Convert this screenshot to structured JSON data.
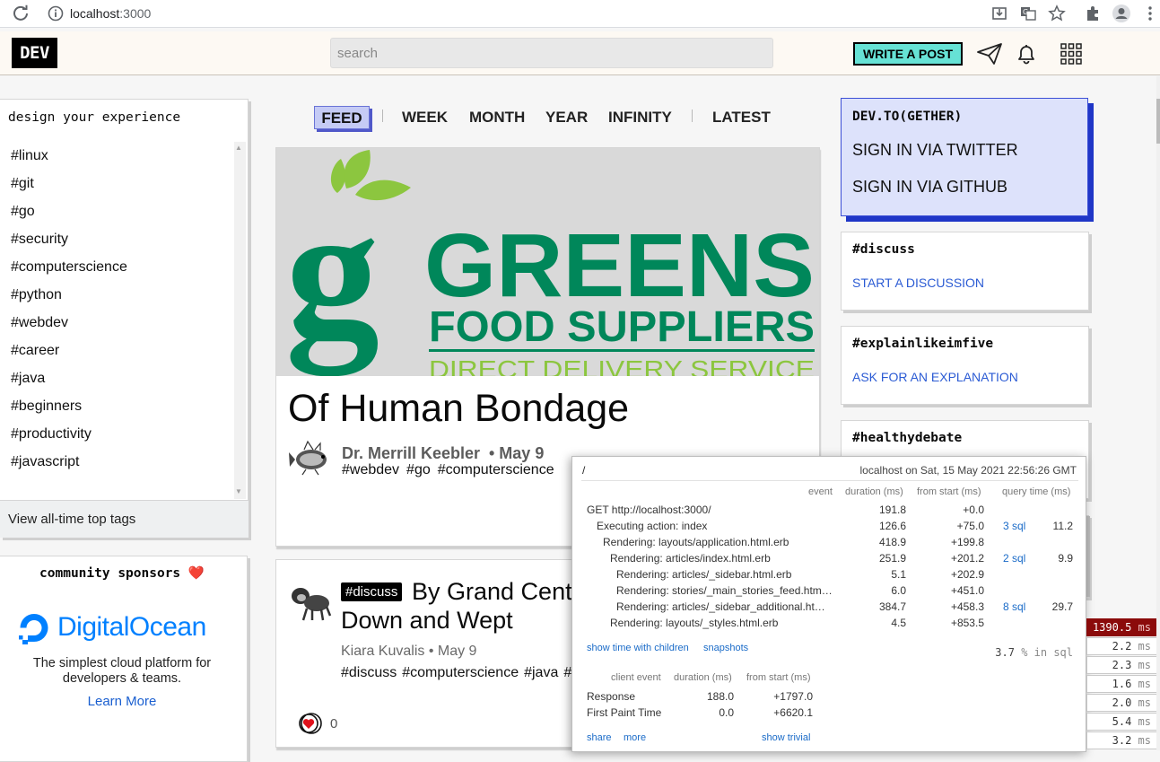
{
  "browser": {
    "url_host": "localhost",
    "url_port": ":3000"
  },
  "header": {
    "logo": "DEV",
    "search_placeholder": "search",
    "write_post": "WRITE A POST"
  },
  "left": {
    "design_title": "design your experience",
    "tags": [
      "#linux",
      "#git",
      "#go",
      "#security",
      "#computerscience",
      "#python",
      "#webdev",
      "#career",
      "#java",
      "#beginners",
      "#productivity",
      "#javascript"
    ],
    "all_time": "View all-time top tags",
    "sponsor_title": "community sponsors ❤️",
    "sponsor_name": "DigitalOcean",
    "sponsor_desc": "The simplest cloud platform for developers & teams.",
    "sponsor_link": "Learn More"
  },
  "feed_nav": {
    "feed": "FEED",
    "week": "WEEK",
    "month": "MONTH",
    "year": "YEAR",
    "infinity": "INFINITY",
    "latest": "LATEST"
  },
  "card1": {
    "cover_line1": "GREENS",
    "cover_line2": "FOOD SUPPLIERS",
    "cover_line3": "DIRECT DELIVERY SERVICE",
    "title": "Of Human Bondage",
    "author": "Dr. Merrill Keebler",
    "date": "• May 9",
    "tags": [
      "#webdev",
      "#go",
      "#computerscience"
    ]
  },
  "card2": {
    "badge": "#discuss",
    "title_line1": "By Grand Cent",
    "title_line2": "Down and Wept",
    "author_line": "Kiara Kuvalis • May 9",
    "tags": [
      "#discuss",
      "#computerscience",
      "#java",
      "#"
    ],
    "reactions": "0"
  },
  "right": {
    "signin_title": "DEV.TO(GETHER)",
    "signin_twitter": "SIGN IN VIA TWITTER",
    "signin_github": "SIGN IN VIA GITHUB",
    "cards": [
      {
        "title": "#discuss",
        "link": "START A DISCUSSION"
      },
      {
        "title": "#explainlikeimfive",
        "link": "ASK FOR AN EXPLANATION"
      },
      {
        "title": "#healthydebate",
        "link": ""
      }
    ]
  },
  "profiler": {
    "path": "/",
    "host": "localhost on Sat, 15 May 2021 22:56:26 GMT",
    "headers": {
      "event": "event",
      "duration": "duration (ms)",
      "from_start": "from start (ms)",
      "query_time": "query time (ms)"
    },
    "rows": [
      {
        "event": "GET http://localhost:3000/",
        "duration": "191.8",
        "from_start": "+0.0",
        "sql": "",
        "query_time": ""
      },
      {
        "event": "Executing action: index",
        "duration": "126.6",
        "from_start": "+75.0",
        "sql": "3 sql",
        "query_time": "11.2"
      },
      {
        "event": "Rendering: layouts/application.html.erb",
        "duration": "418.9",
        "from_start": "+199.8",
        "sql": "",
        "query_time": ""
      },
      {
        "event": "Rendering: articles/index.html.erb",
        "duration": "251.9",
        "from_start": "+201.2",
        "sql": "2 sql",
        "query_time": "9.9"
      },
      {
        "event": "Rendering: articles/_sidebar.html.erb",
        "duration": "5.1",
        "from_start": "+202.9",
        "sql": "",
        "query_time": ""
      },
      {
        "event": "Rendering: stories/_main_stories_feed.htm…",
        "duration": "6.0",
        "from_start": "+451.0",
        "sql": "",
        "query_time": ""
      },
      {
        "event": "Rendering: articles/_sidebar_additional.ht…",
        "duration": "384.7",
        "from_start": "+458.3",
        "sql": "8 sql",
        "query_time": "29.7"
      },
      {
        "event": "Rendering: layouts/_styles.html.erb",
        "duration": "4.5",
        "from_start": "+853.5",
        "sql": "",
        "query_time": ""
      }
    ],
    "show_time": "show time with children",
    "snapshots": "snapshots",
    "pct_value": "3.7",
    "pct_label": "% in sql",
    "client_headers": {
      "event": "client event",
      "duration": "duration (ms)",
      "from_start": "from start (ms)"
    },
    "client_rows": [
      {
        "event": "Response",
        "duration": "188.0",
        "from_start": "+1797.0"
      },
      {
        "event": "First Paint Time",
        "duration": "0.0",
        "from_start": "+6620.1"
      }
    ],
    "share": "share",
    "more": "more",
    "show_trivial": "show trivial"
  },
  "mini_profiler": [
    {
      "value": "1390.5",
      "unit": "ms"
    },
    {
      "value": "2.2",
      "unit": "ms"
    },
    {
      "value": "2.3",
      "unit": "ms"
    },
    {
      "value": "1.6",
      "unit": "ms"
    },
    {
      "value": "2.0",
      "unit": "ms"
    },
    {
      "value": "5.4",
      "unit": "ms"
    },
    {
      "value": "3.2",
      "unit": "ms"
    }
  ]
}
